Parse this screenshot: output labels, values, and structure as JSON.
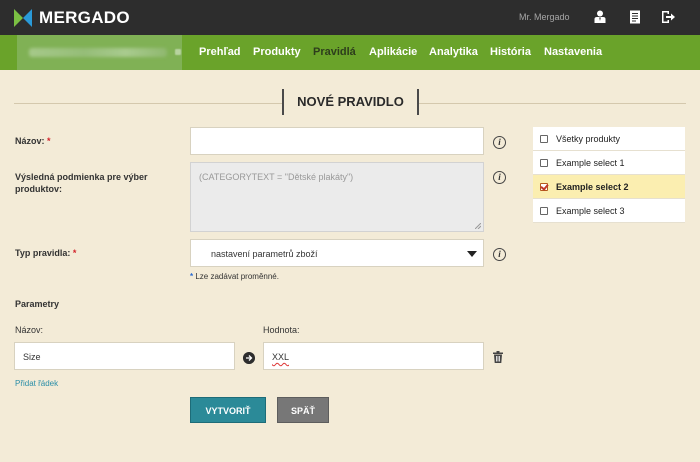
{
  "app": {
    "brand": "MERGADO",
    "user": "Mr. Mergado",
    "icons": [
      "users-icon",
      "document-icon",
      "logout-icon"
    ]
  },
  "nav": {
    "items": [
      {
        "label": "Prehľad",
        "active": false
      },
      {
        "label": "Produkty",
        "active": false
      },
      {
        "label": "Pravidlá",
        "active": true
      },
      {
        "label": "Aplikácie",
        "active": false
      },
      {
        "label": "Analytika",
        "active": false
      },
      {
        "label": "História",
        "active": false
      },
      {
        "label": "Nastavenia",
        "active": false
      }
    ]
  },
  "form": {
    "title": "NOVÉ PRAVIDLO",
    "name_label": "Názov:",
    "required_mark": "*",
    "name_value": "",
    "condition_label": "Výsledná podmienka pre výber produktov:",
    "condition_value": "(CATEGORYTEXT = \"Dětské plakáty\")",
    "type_label": "Typ pravidla:",
    "type_value": "nastavení parametrů zboží",
    "hint_star": "*",
    "hint_text": "Lze zadávat proměnné.",
    "params_heading": "Parametry",
    "param_name_label": "Názov:",
    "param_value_label": "Hodnota:",
    "param_name_value": "Size",
    "param_value_value": "XXL",
    "add_row_link": "Přidat řádek",
    "create_button": "VYTVORIŤ",
    "back_button": "SPÄŤ"
  },
  "selects": [
    {
      "label": "Všetky produkty",
      "checked": false
    },
    {
      "label": "Example select 1",
      "checked": false
    },
    {
      "label": "Example select 2",
      "checked": true
    },
    {
      "label": "Example select 3",
      "checked": false
    }
  ],
  "colors": {
    "topbar": "#2d2d2d",
    "navbar": "#6aa32a",
    "background": "#f3ebd7",
    "primary_button": "#2b8a98",
    "secondary_button": "#777777",
    "selected_row": "#fbeeb0",
    "link": "#2a8ea8"
  }
}
